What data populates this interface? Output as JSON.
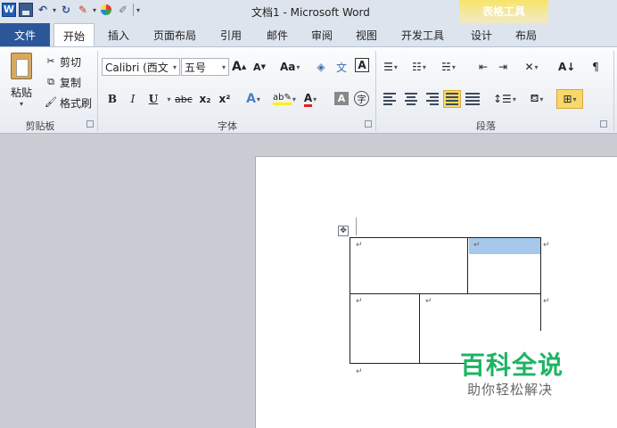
{
  "window": {
    "title": "文档1 - Microsoft Word"
  },
  "quick_access": {
    "word_logo": "W",
    "icons": [
      "word-logo-icon",
      "save-icon",
      "undo-icon",
      "redo-icon",
      "format-painter-icon",
      "color-icon",
      "pen-icon",
      "customize-icon"
    ]
  },
  "context_group": {
    "label": "表格工具"
  },
  "tabs": {
    "file": "文件",
    "items": [
      "开始",
      "插入",
      "页面布局",
      "引用",
      "邮件",
      "审阅",
      "视图",
      "开发工具",
      "设计",
      "布局"
    ]
  },
  "clipboard": {
    "paste": "粘贴",
    "cut": "剪切",
    "copy": "复制",
    "format_painter": "格式刷",
    "group_label": "剪贴板"
  },
  "font": {
    "font_name": "Calibri (西文",
    "font_size": "五号",
    "group_label": "字体",
    "grow": "A",
    "shrink": "A",
    "change_case": "Aa",
    "bold": "B",
    "italic": "I",
    "underline": "U",
    "strike": "abc",
    "subscript": "x₂",
    "superscript": "x²",
    "phonetic": "文",
    "char_border": "A",
    "font_color": "A",
    "char_shading": "A",
    "enclose": "字"
  },
  "paragraph": {
    "group_label": "段落"
  },
  "watermark": {
    "title": "百科全说",
    "subtitle": "助你轻松解决"
  },
  "document": {
    "paragraph_mark": "↵"
  },
  "colors": {
    "file_tab": "#2b579a",
    "context_group": "#f7e46a",
    "selection": "#a6c8ea",
    "watermark": "#1db464"
  }
}
